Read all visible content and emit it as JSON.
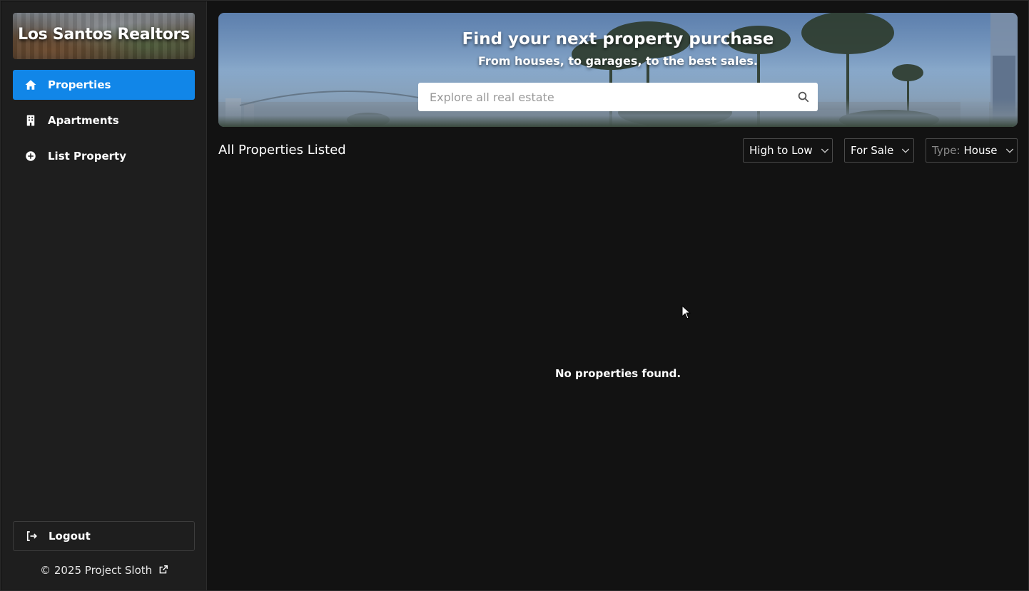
{
  "sidebar": {
    "brand_title": "Los Santos Realtors",
    "items": [
      {
        "label": "Properties",
        "icon": "home-icon",
        "active": true
      },
      {
        "label": "Apartments",
        "icon": "building-icon",
        "active": false
      },
      {
        "label": "List Property",
        "icon": "plus-circle-icon",
        "active": false
      }
    ],
    "logout_label": "Logout",
    "footer_text": "© 2025 Project Sloth"
  },
  "hero": {
    "title": "Find your next property purchase",
    "subtitle": "From houses, to garages, to the best sales.",
    "search_placeholder": "Explore all real estate"
  },
  "listing": {
    "section_title": "All Properties Listed",
    "sort_label": "High to Low",
    "status_label": "For Sale",
    "type_prefix": "Type:",
    "type_value": "House",
    "empty_message": "No properties found."
  },
  "colors": {
    "accent": "#1186e8",
    "background": "#121212",
    "sidebar": "#1e1e1e"
  }
}
